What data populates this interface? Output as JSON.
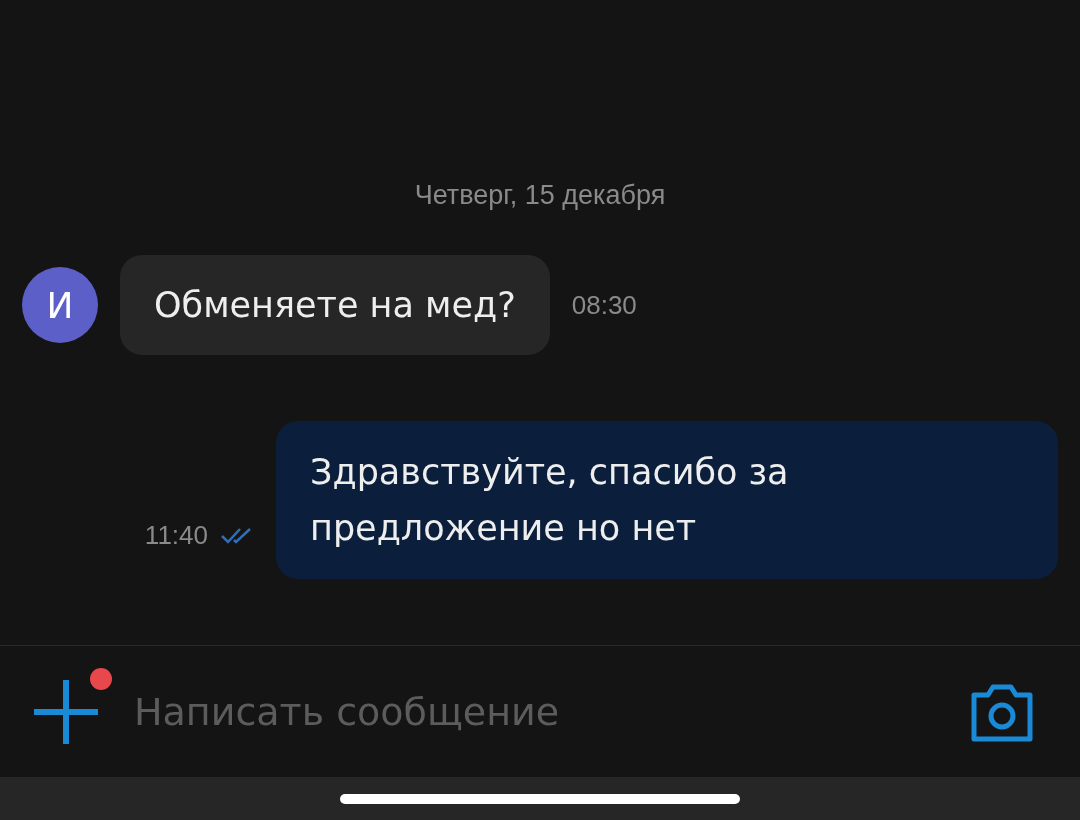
{
  "date_label": "Четверг, 15 декабря",
  "messages": [
    {
      "kind": "incoming",
      "avatar": "И",
      "text": "Обменяете на мед?",
      "time": "08:30"
    },
    {
      "kind": "outgoing",
      "text": "Здравствуйте, спасибо за предложение но нет",
      "time": "11:40",
      "read": true
    }
  ],
  "composer": {
    "placeholder": "Написать сообщение",
    "attach_badge": true
  }
}
